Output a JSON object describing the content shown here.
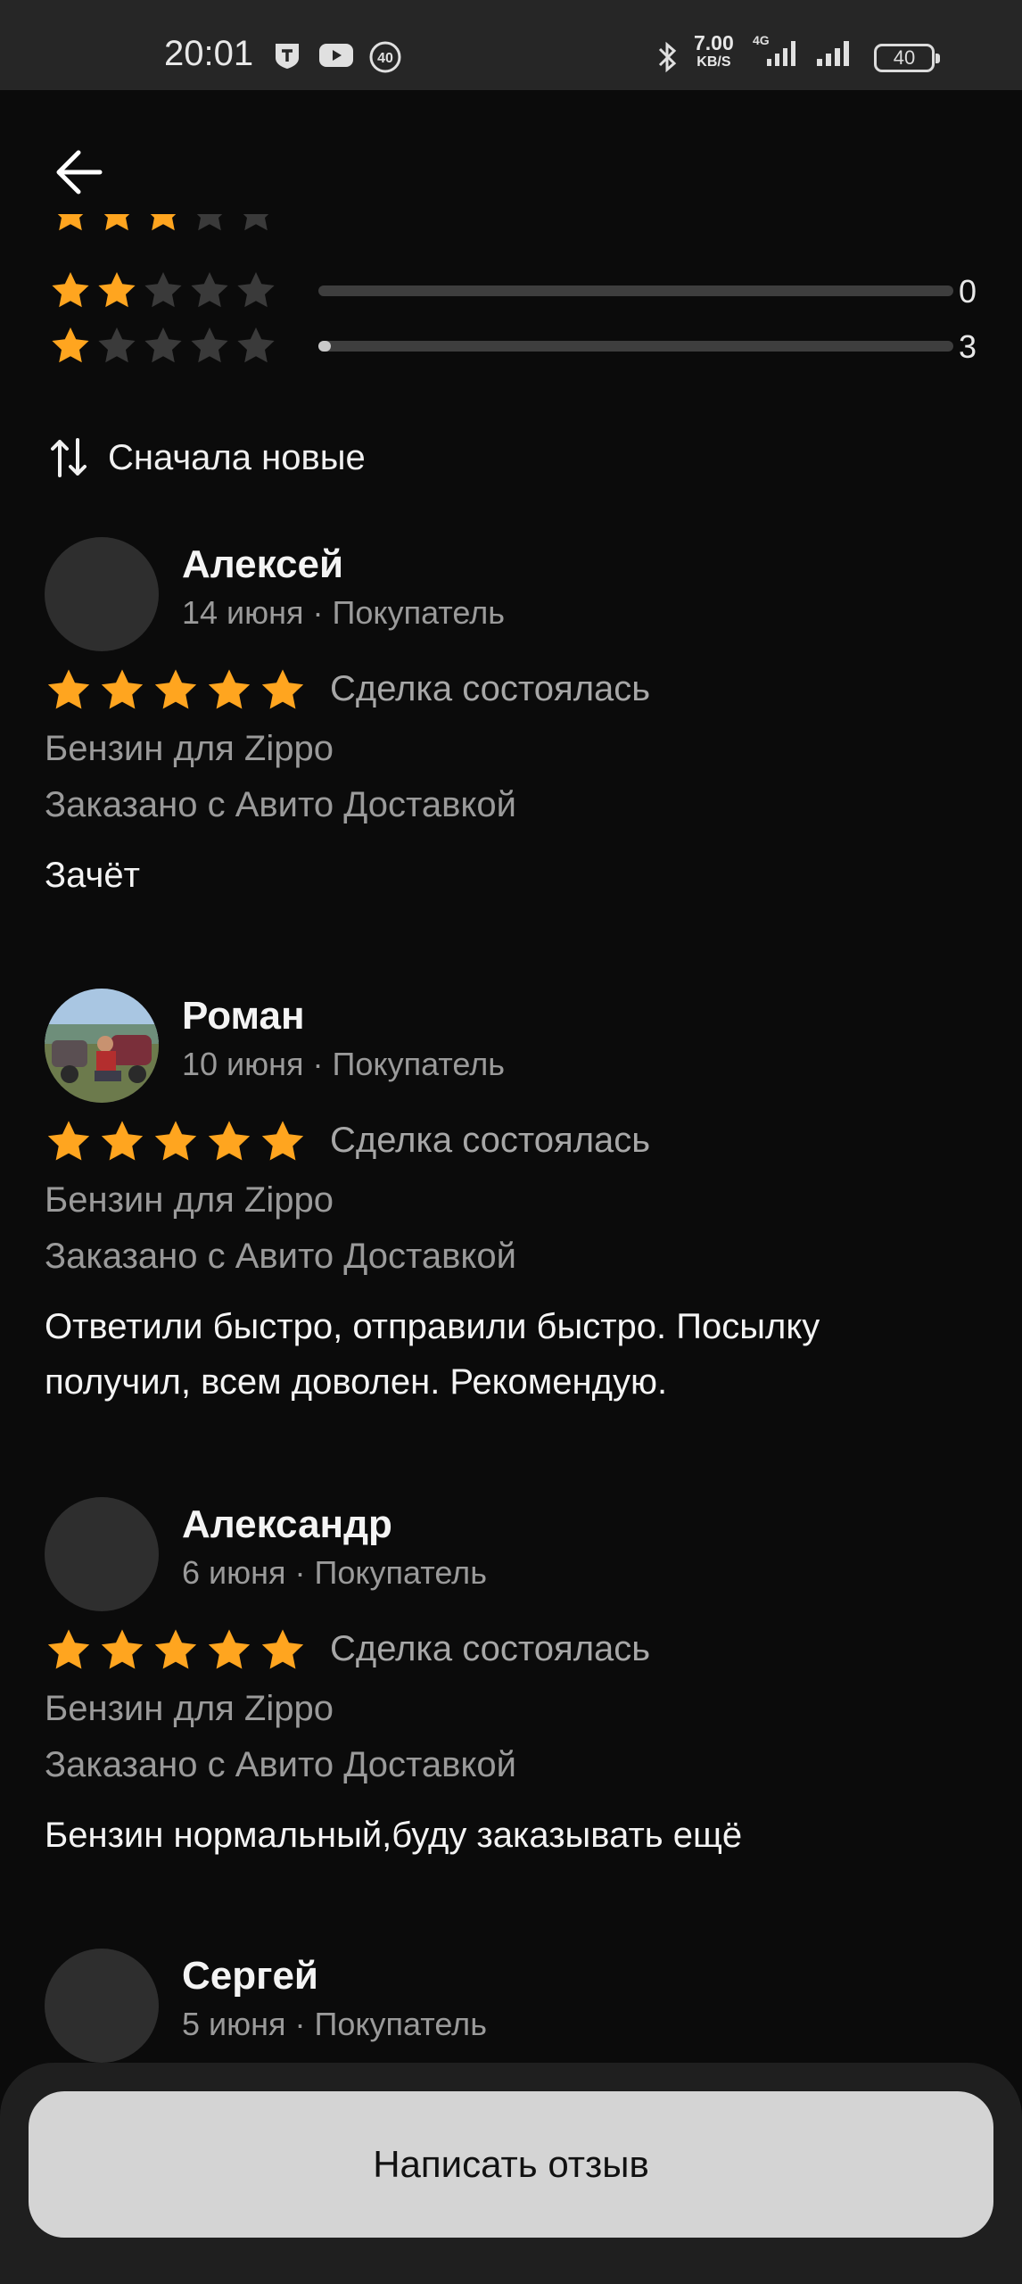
{
  "status_bar": {
    "time": "20:01",
    "notification_badge": "40",
    "net_speed_value": "7.00",
    "net_speed_unit": "KB/S",
    "network_type": "4G",
    "battery_level": "40"
  },
  "rating_breakdown": [
    {
      "stars": 3,
      "count": null,
      "fill": 0.0
    },
    {
      "stars": 2,
      "count": "0",
      "fill": 0.0
    },
    {
      "stars": 1,
      "count": "3",
      "fill": 0.01
    }
  ],
  "sort": {
    "label": "Сначала новые"
  },
  "reviews": [
    {
      "name": "Алексей",
      "meta": "14 июня · Покупатель",
      "rating": 5,
      "deal": "Сделка состоялась",
      "product": "Бензин для Zippo",
      "delivery": "Заказано с Авито Доставкой",
      "text": "Зачёт",
      "has_photo": false
    },
    {
      "name": "Роман",
      "meta": "10 июня · Покупатель",
      "rating": 5,
      "deal": "Сделка состоялась",
      "product": "Бензин для Zippo",
      "delivery": "Заказано с Авито Доставкой",
      "text": "Ответили быстро, отправили быстро. Посылку получил, всем доволен. Рекомендую.",
      "has_photo": true
    },
    {
      "name": "Александр",
      "meta": "6 июня · Покупатель",
      "rating": 5,
      "deal": "Сделка состоялась",
      "product": "Бензин для Zippo",
      "delivery": "Заказано с Авито Доставкой",
      "text": "Бензин нормальный,буду заказывать ещё",
      "has_photo": false
    },
    {
      "name": "Сергей",
      "meta": "5 июня · Покупатель",
      "has_photo": false
    }
  ],
  "write_review_button": "Написать отзыв",
  "colors": {
    "star_active": "#ffa51f",
    "star_inactive": "#3a3a3a",
    "background": "#0b0b0b"
  }
}
